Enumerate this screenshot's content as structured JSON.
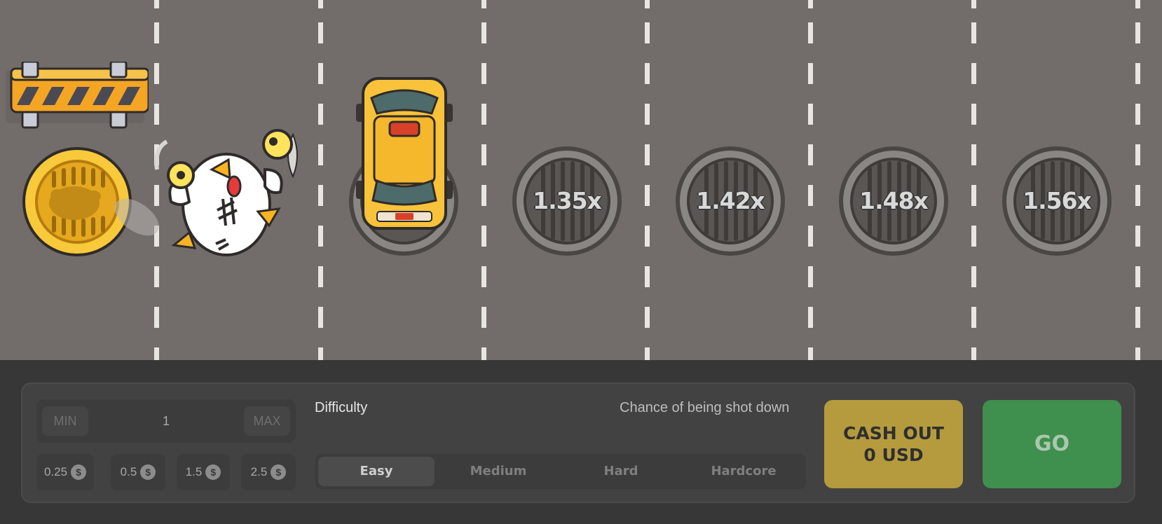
{
  "lanes": {
    "multipliers": [
      "1.35x",
      "1.42x",
      "1.48x",
      "1.56x"
    ]
  },
  "bet": {
    "min_label": "MIN",
    "max_label": "MAX",
    "amount": "1",
    "chips": [
      "0.25",
      "0.5",
      "1.5",
      "2.5"
    ],
    "currency_icon": "$"
  },
  "difficulty": {
    "label": "Difficulty",
    "hint": "Chance of being shot down",
    "options": [
      "Easy",
      "Medium",
      "Hard",
      "Hardcore"
    ],
    "selected": "Easy"
  },
  "actions": {
    "cashout_line1": "CASH OUT",
    "cashout_line2": "0 USD",
    "go_label": "GO"
  },
  "colors": {
    "road": "#726d6a",
    "cashout": "#b59b3e",
    "go": "#3f8f4e",
    "coin": "#f5c431"
  }
}
